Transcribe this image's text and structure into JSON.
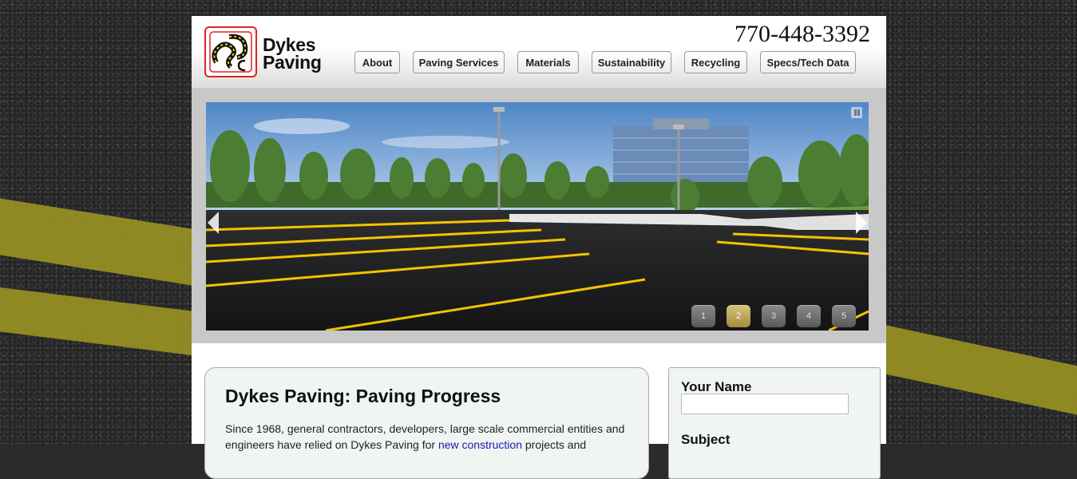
{
  "brand": {
    "line1": "Dykes",
    "line2": "Paving",
    "logo_icon": "dp-logo-icon"
  },
  "phone": "770-448-3392",
  "nav": {
    "items": [
      {
        "label": "About"
      },
      {
        "label": "Paving Services"
      },
      {
        "label": "Materials"
      },
      {
        "label": "Sustainability"
      },
      {
        "label": "Recycling"
      },
      {
        "label": "Specs/Tech Data"
      }
    ]
  },
  "slider": {
    "pages": [
      "1",
      "2",
      "3",
      "4",
      "5"
    ],
    "active_page": "2",
    "prev_icon": "arrow-left-icon",
    "next_icon": "arrow-right-icon",
    "pause_icon": "pause-icon"
  },
  "content": {
    "title": "Dykes Paving: Paving Progress",
    "text_before_link": "Since 1968, general contractors, developers, large scale commercial entities and engineers have relied on Dykes Paving for ",
    "link": "new construction",
    "text_after_link": " projects and"
  },
  "form": {
    "name_label": "Your Name",
    "subject_label": "Subject"
  },
  "colors": {
    "stripe": "#9a9424",
    "logo_red": "#dd2222",
    "link": "#1a1ab3",
    "panel": "#f0f5f1"
  }
}
